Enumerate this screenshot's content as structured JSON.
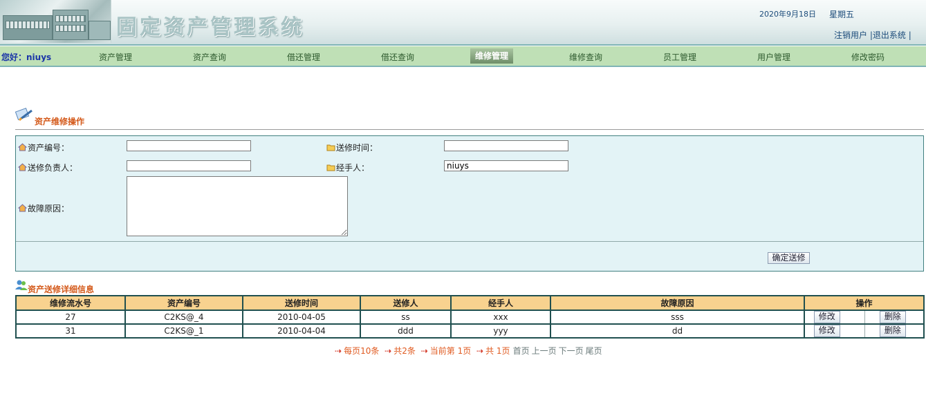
{
  "header": {
    "system_title": "固定资产管理系统",
    "date": "2020年9月18日",
    "weekday": "星期五",
    "logout_user": "注销用户",
    "exit_system": "退出系统",
    "sep": "|"
  },
  "nav": {
    "greeting": "您好：niuys",
    "items": [
      {
        "label": "资产管理"
      },
      {
        "label": "资产查询"
      },
      {
        "label": "借还管理"
      },
      {
        "label": "借还查询"
      },
      {
        "label": "维修管理"
      },
      {
        "label": "维修查询"
      },
      {
        "label": "员工管理"
      },
      {
        "label": "用户管理"
      },
      {
        "label": "修改密码"
      }
    ],
    "active": "维修管理"
  },
  "form": {
    "section_title": "资产维修操作",
    "asset_no_label": "资产编号：",
    "asset_no_value": "",
    "send_time_label": "送修时间：",
    "send_time_value": "",
    "sender_label": "送修负责人：",
    "sender_value": "",
    "handler_label": "经手人：",
    "handler_value": "niuys",
    "fault_label": "故障原因：",
    "fault_value": "",
    "submit_label": "确定送修"
  },
  "records": {
    "section_title": "资产送修详细信息",
    "columns": [
      "维修流水号",
      "资产编号",
      "送修时间",
      "送修人",
      "经手人",
      "故障原因",
      "操作"
    ],
    "rows": [
      {
        "id": "27",
        "asset": "C2KS@_4",
        "time": "2010-04-05",
        "sender": "ss",
        "handler": "xxx",
        "reason": "sss",
        "edit": "修改",
        "delete": "删除"
      },
      {
        "id": "31",
        "asset": "C2KS@_1",
        "time": "2010-04-04",
        "sender": "ddd",
        "handler": "yyy",
        "reason": "dd",
        "edit": "修改",
        "delete": "删除"
      }
    ]
  },
  "pager": {
    "per_page": "每页10条",
    "total": "共2条",
    "current": "当前第 1页",
    "pages": "共 1页",
    "first": "首页",
    "prev": "上一页",
    "next": "下一页",
    "last": "尾页"
  },
  "colors": {
    "nav_bg": "#bfe0b6",
    "section_title": "#d45a1b",
    "table_header": "#f8d28f",
    "panel_bg": "#e3f3f6"
  }
}
